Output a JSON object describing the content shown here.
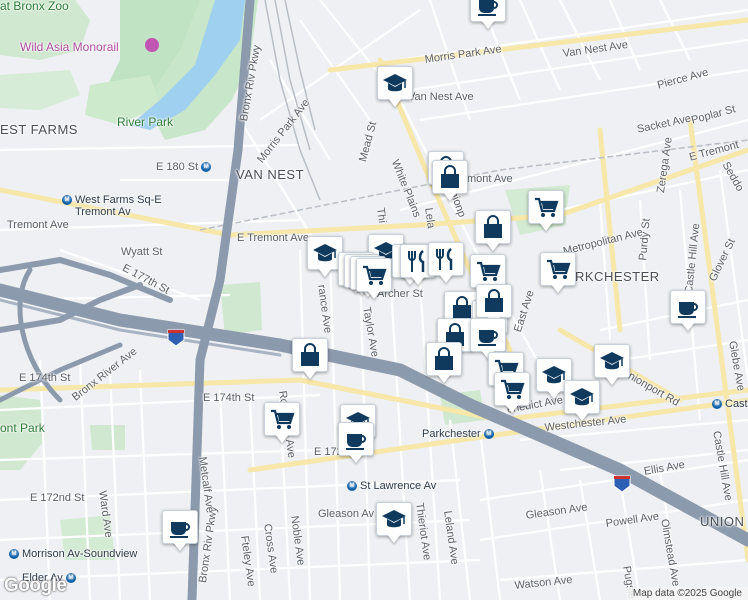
{
  "map": {
    "attribution": "Map data ©2025 Google",
    "logo": "Google"
  },
  "labels": {
    "zoo": "at Bronx Zoo",
    "monorail": "Wild Asia Monorail",
    "river_park": "River Park",
    "west_farms_area": "EST FARMS",
    "van_nest_area": "VAN NEST",
    "parkchester_area": "RKCHESTER",
    "unionport_area": "UNION",
    "bronx_riv_pkwy_n": "Bronx Riv Pkwy",
    "bronx_riv_pkwy_s": "Bronx Riv Pkwy",
    "morris_park_ave_w": "Morris Park Ave",
    "morris_park_ave_e": "Morris Park Ave",
    "van_nest_ave_e": "Van Nest Ave",
    "van_nest_ave": "Van Nest Ave",
    "pierce_ave": "Pierce Ave",
    "sacket_ave": "Sacket Ave",
    "poplar_st": "Poplar St",
    "e_tremont_e": "E Tremont",
    "seddon": "Seddo",
    "mead_st": "Mead St",
    "white_plains": "White Plains",
    "unionport_rd_n": "Unionp",
    "e_tremont_ave_mid": "E Tremont Ave",
    "e_tremont_ave_west": "Tremont Ave",
    "e_tremont_ave_near": "mont Ave",
    "e_180_st": "E 180 St",
    "west_farms_sta": "West Farms Sq-E",
    "west_farms_sta2": "Tremont Av",
    "wyatt_st": "Wyatt St",
    "e_177th_st": "E 177th St",
    "metropolitan_ave": "Metropolitan Ave",
    "zerega_ave": "Zerega Ave",
    "castle_hill_ave_n": "Castle Hill Ave",
    "purdy_st": "Purdy St",
    "glover_st": "Glover St",
    "glebe_ave": "Glebe Ave",
    "archer_st": "Archer St",
    "taylor_ave": "Taylor Ave",
    "beach_ave": "Bea",
    "rance_ave": "rance Ave",
    "thieriot_n": "Thi",
    "leland_n": "Lela",
    "east_ave": "East Ave",
    "unionport_rd_s": "nionport Rd",
    "castle_hill_sta": "Cast",
    "i95": "95",
    "i95_b": "95",
    "bronx_river_ave": "Bronx River Ave",
    "e_174th_st_w": "E 174th St",
    "e_174th_st": "E 174th St",
    "rosedale_ave": "Rosedale Ave",
    "e_172": "E 172",
    "westchester_ave": "Westchester Ave",
    "benedict_ave": "enedict Ave",
    "parkchester_sta": "Parkchester",
    "ellis_ave": "Ellis Ave",
    "castle_hill_ave_s": "Castle Hill Ave",
    "st_lawrence_sta": "St Lawrence Av",
    "e_172nd_st": "E 172nd St",
    "metcalf_ave": "Metcalf Ave",
    "ward_ave": "Ward Ave",
    "cross_ave": "Cross Ave",
    "noble_ave": "Noble Ave",
    "fteley_ave": "Fteley Ave",
    "gleason_ave_w": "Gleason Av",
    "gleason_ave": "Gleason Ave",
    "powell_ave": "Powell Ave",
    "olmstead_ave": "Olmstead Ave",
    "pugsley": "Pugsle",
    "watson_ave": "Watson Ave",
    "thieriot_s": "Thieriot Ave",
    "leland_s": "Leland Ave",
    "morrison_sta": "Morrison Av-Soundview",
    "elder_sta": "Elder Av",
    "park_w": "ont Park"
  },
  "markers": [
    {
      "type": "coffee"
    },
    {
      "type": "school"
    },
    {
      "type": "shopping"
    },
    {
      "type": "shopping"
    },
    {
      "type": "grocery"
    },
    {
      "type": "shopping"
    },
    {
      "type": "school"
    },
    {
      "type": "school"
    },
    {
      "type": "grocery"
    },
    {
      "type": "grocery"
    },
    {
      "type": "grocery"
    },
    {
      "type": "grocery"
    },
    {
      "type": "restaurant"
    },
    {
      "type": "restaurant"
    },
    {
      "type": "restaurant"
    },
    {
      "type": "grocery"
    },
    {
      "type": "grocery"
    },
    {
      "type": "coffee"
    },
    {
      "type": "shopping"
    },
    {
      "type": "coffee"
    },
    {
      "type": "shopping"
    },
    {
      "type": "shopping"
    },
    {
      "type": "shopping"
    },
    {
      "type": "coffee"
    },
    {
      "type": "grocery"
    },
    {
      "type": "grocery"
    },
    {
      "type": "school"
    },
    {
      "type": "school"
    },
    {
      "type": "school"
    },
    {
      "type": "grocery"
    },
    {
      "type": "school"
    },
    {
      "type": "coffee"
    },
    {
      "type": "school"
    },
    {
      "type": "coffee"
    },
    {
      "type": "shopping"
    }
  ]
}
